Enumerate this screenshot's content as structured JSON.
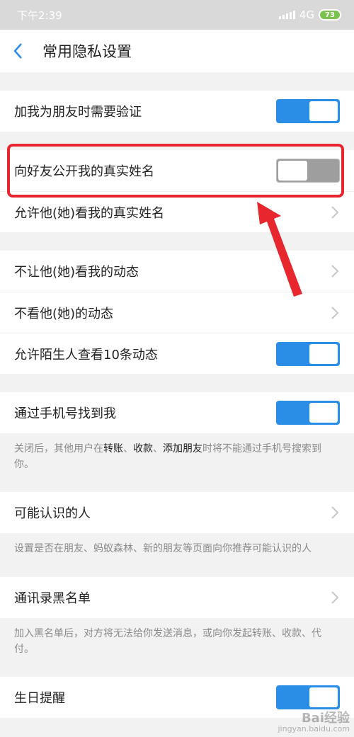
{
  "status_bar": {
    "time": "下午2:39",
    "network": "4G",
    "battery": "73"
  },
  "nav": {
    "title": "常用隐私设置"
  },
  "groups": {
    "verify": {
      "label": "加我为朋友时需要验证",
      "state": "on"
    },
    "name": [
      {
        "label": "向好友公开我的真实姓名",
        "state": "off"
      },
      {
        "label": "允许他(她)看我的真实姓名"
      }
    ],
    "moments": [
      {
        "label": "不让他(她)看我的动态"
      },
      {
        "label": "不看他(她)的动态"
      },
      {
        "label": "允许陌生人查看10条动态",
        "state": "on"
      }
    ],
    "phone": {
      "label": "通过手机号找到我",
      "state": "on",
      "note_pre": "关闭后，其他用户在",
      "note_k1": "转账",
      "note_sep1": "、",
      "note_k2": "收款",
      "note_sep2": "、",
      "note_k3": "添加朋友",
      "note_post": "时将不能通过手机号搜索到你。"
    },
    "maybe_known": {
      "label": "可能认识的人",
      "note": "设置是否在朋友、蚂蚁森林、新的朋友等页面向你推荐可能认识的人"
    },
    "blacklist": {
      "label": "通讯录黑名单",
      "note": "加入黑名单后，对方将无法给你发送消息，或向你发起转账、收款、代付。"
    },
    "birthday": {
      "label": "生日提醒",
      "state": "on"
    }
  },
  "annotation": {
    "color": "#e8262d"
  },
  "watermark": {
    "brand": "Bai经验",
    "url": "jingyan.baidu.com"
  },
  "colors": {
    "toggle_on": "#2b8ee6",
    "toggle_off": "#9e9e9e"
  }
}
